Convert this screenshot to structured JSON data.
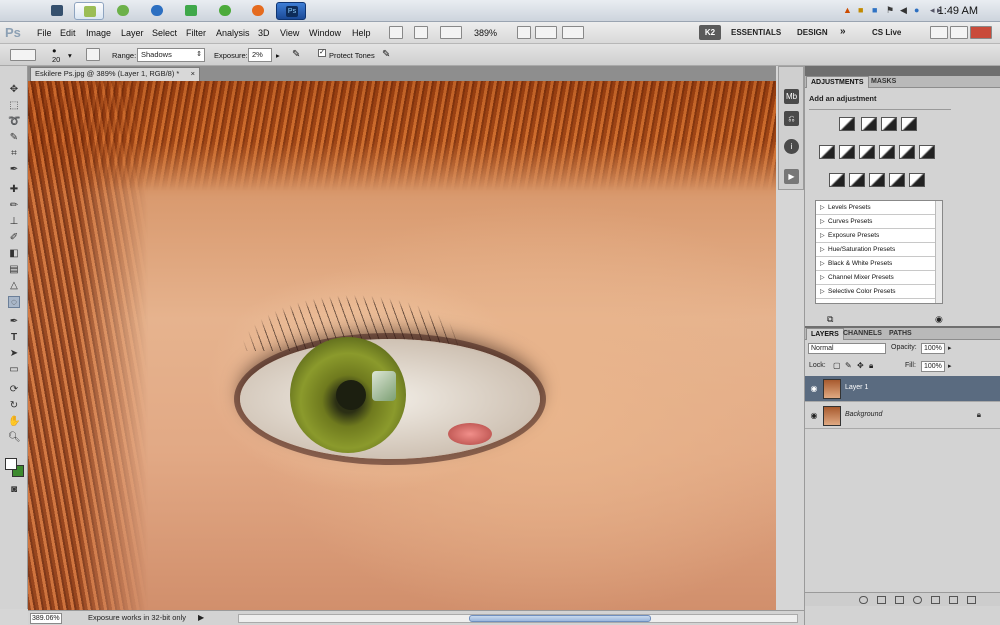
{
  "taskbar": {
    "apps": [
      "explorer-icon",
      "notepad-icon",
      "paint-icon",
      "browser-icon",
      "folder-icon",
      "chat-icon",
      "firefox-icon",
      "photoshop-icon"
    ],
    "tray_text": "◂ ▸",
    "clock": "1:49 AM"
  },
  "menubar": {
    "logo": "Ps",
    "items": [
      "File",
      "Edit",
      "Image",
      "Layer",
      "Select",
      "Filter",
      "Analysis",
      "3D",
      "View",
      "Window",
      "Help"
    ],
    "zoom": "389%",
    "workspace_badge": "K2",
    "workspaces": [
      "ESSENTIALS",
      "DESIGN"
    ],
    "more": "»",
    "cs_live": "CS Live"
  },
  "options": {
    "brush_size": "20",
    "range_label": "Range:",
    "range_value": "Shadows",
    "exposure_label": "Exposure:",
    "exposure_value": "2%",
    "protect_label": "Protect Tones"
  },
  "document": {
    "tab_title": "Eskilere Ps.jpg @ 389% (Layer 1, RGB/8) *",
    "close": "×"
  },
  "status": {
    "zoom": "389.06%",
    "message": "Exposure works in 32-bit only"
  },
  "adjustments": {
    "tabs": [
      "ADJUSTMENTS",
      "MASKS"
    ],
    "heading": "Add an adjustment",
    "presets": [
      "Levels Presets",
      "Curves Presets",
      "Exposure Presets",
      "Hue/Saturation Presets",
      "Black & White Presets",
      "Channel Mixer Presets",
      "Selective Color Presets"
    ]
  },
  "layers": {
    "tabs": [
      "LAYERS",
      "CHANNELS",
      "PATHS"
    ],
    "blend_mode": "Normal",
    "opacity_label": "Opacity:",
    "opacity_value": "100%",
    "lock_label": "Lock:",
    "fill_label": "Fill:",
    "fill_value": "100%",
    "items": [
      {
        "name": "Layer 1",
        "selected": true
      },
      {
        "name": "Background",
        "selected": false
      }
    ]
  },
  "colors": {
    "accent": "#5a6b80",
    "foreground": "#ffffff",
    "background_swatch": "#3c8a2e"
  }
}
